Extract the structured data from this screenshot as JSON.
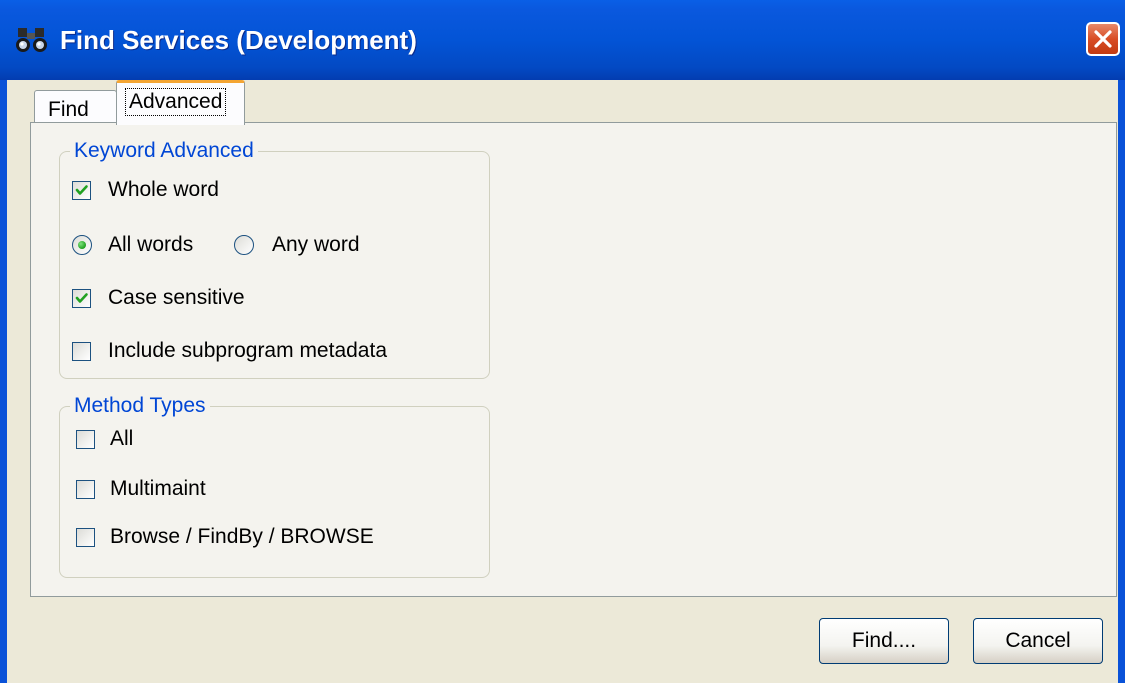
{
  "window": {
    "title": "Find Services (Development)",
    "close_icon": "close-icon",
    "title_icon": "binoculars-icon"
  },
  "tabs": [
    {
      "label": "Find",
      "selected": false
    },
    {
      "label": "Advanced",
      "selected": true
    }
  ],
  "keyword_group": {
    "legend": "Keyword Advanced",
    "whole_word": {
      "label": "Whole word",
      "checked": true
    },
    "all_words": {
      "label": "All words",
      "selected": true
    },
    "any_word": {
      "label": "Any word",
      "selected": false
    },
    "case_sensitive": {
      "label": "Case sensitive",
      "checked": true
    },
    "include_subprogram": {
      "label": "Include subprogram metadata",
      "checked": false
    }
  },
  "method_group": {
    "legend": "Method Types",
    "all": {
      "label": "All",
      "checked": false
    },
    "multimaint": {
      "label": "Multimaint",
      "checked": false
    },
    "browse": {
      "label": "Browse / FindBy / BROWSE",
      "checked": false
    }
  },
  "buttons": {
    "find": "Find....",
    "cancel": "Cancel"
  },
  "colors": {
    "titlebar": "#0354d6",
    "dialog_bg": "#ece9d8",
    "group_legend": "#0046d5",
    "tab_accent": "#f4a532",
    "check_mark": "#21a121",
    "close_button": "#d94d25"
  }
}
